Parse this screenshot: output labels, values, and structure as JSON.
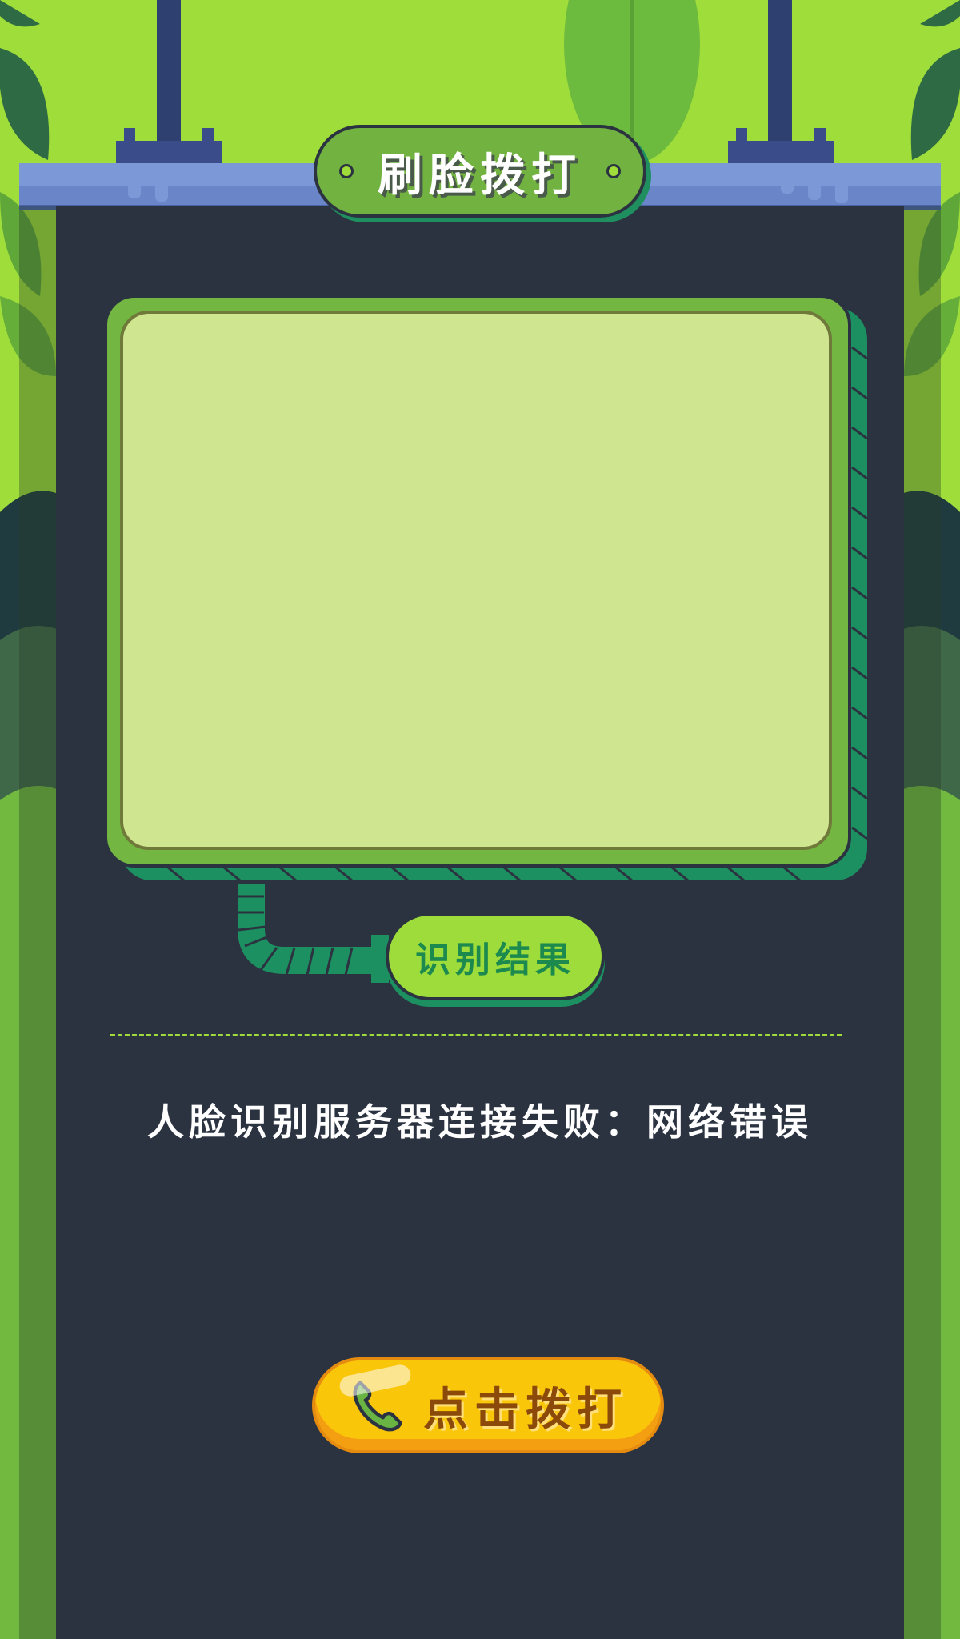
{
  "header": {
    "title": "刷脸拨打"
  },
  "preview": {},
  "result": {
    "label": "识别结果"
  },
  "status": {
    "message": "人脸识别服务器连接失败：网络错误"
  },
  "call_button": {
    "label": "点击拨打",
    "icon": "phone-icon"
  },
  "colors": {
    "background": "#9fdd3a",
    "panel": "#2b3341",
    "accent_green": "#74b642",
    "button_yellow": "#f9c60a"
  }
}
